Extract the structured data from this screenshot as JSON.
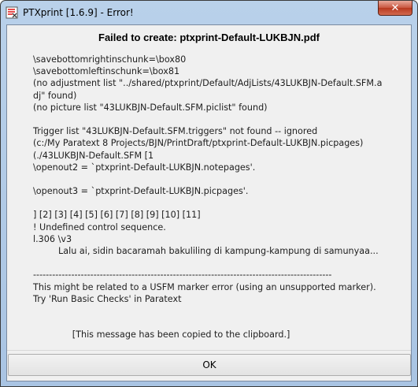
{
  "window": {
    "title": "PTXprint [1.6.9] - Error!",
    "close_glyph": "✕"
  },
  "dialog": {
    "heading": "Failed to create: ptxprint-Default-LUKBJN.pdf",
    "lines": [
      "\\savebottomrightinschunk=\\box80",
      "\\savebottomleftinschunk=\\box81",
      "(no adjustment list \"../shared/ptxprint/Default/AdjLists/43LUKBJN-Default.SFM.a",
      "dj\" found)",
      "(no picture list \"43LUKBJN-Default.SFM.piclist\" found)",
      "",
      "Trigger list \"43LUKBJN-Default.SFM.triggers\" not found -- ignored",
      "(c:/My Paratext 8 Projects/BJN/PrintDraft/ptxprint-Default-LUKBJN.picpages)",
      "(./43LUKBJN-Default.SFM [1",
      "\\openout2 = `ptxprint-Default-LUKBJN.notepages'.",
      "",
      "\\openout3 = `ptxprint-Default-LUKBJN.picpages'.",
      "",
      "] [2] [3] [4] [5] [6] [7] [8] [9] [10] [11]",
      "! Undefined control sequence.",
      "l.306 \\v3",
      "         Lalu ai, sidin bacaramah bakuliling di kampung-kampung di samunyaa...",
      "",
      "----------------------------------------------------------------------------------------------",
      "This might be related to a USFM marker error (using an unsupported marker).",
      "Try 'Run Basic Checks' in Paratext",
      "",
      "",
      "              [This message has been copied to the clipboard.]"
    ]
  },
  "buttons": {
    "ok_label": "OK"
  }
}
